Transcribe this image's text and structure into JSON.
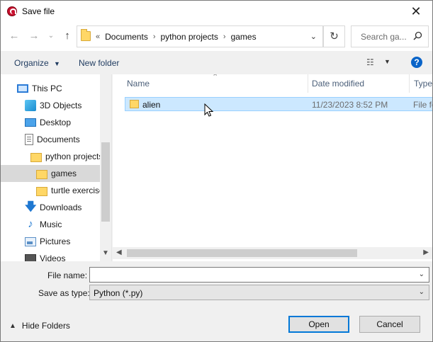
{
  "window": {
    "title": "Save file",
    "close_glyph": "✕"
  },
  "nav": {
    "back_glyph": "←",
    "forward_glyph": "→",
    "recent_glyph": "⌄",
    "up_glyph": "↑",
    "breadcrumb_prefix": "«",
    "breadcrumbs": [
      "Documents",
      "python projects",
      "games"
    ],
    "refresh_glyph": "↻",
    "search_placeholder": "Search ga..."
  },
  "toolbar": {
    "organize_label": "Organize",
    "new_folder_label": "New folder",
    "view_glyph": "☷",
    "help_glyph": "?"
  },
  "tree": [
    {
      "label": "This PC",
      "icon": "pc-icon",
      "indent": 0,
      "expand": "›"
    },
    {
      "label": "3D Objects",
      "icon": "3d-objects-icon",
      "indent": 1
    },
    {
      "label": "Desktop",
      "icon": "desktop-icon",
      "indent": 1
    },
    {
      "label": "Documents",
      "icon": "documents-icon",
      "indent": 1
    },
    {
      "label": "python projects",
      "icon": "folder-icon",
      "indent": 2
    },
    {
      "label": "games",
      "icon": "folder-icon",
      "indent": 3,
      "selected": true
    },
    {
      "label": "turtle exercises",
      "icon": "folder-icon",
      "indent": 3
    },
    {
      "label": "Downloads",
      "icon": "downloads-icon",
      "indent": 1
    },
    {
      "label": "Music",
      "icon": "music-icon",
      "indent": 1
    },
    {
      "label": "Pictures",
      "icon": "pictures-icon",
      "indent": 1
    },
    {
      "label": "Videos",
      "icon": "videos-icon",
      "indent": 1
    }
  ],
  "columns": {
    "name": "Name",
    "date": "Date modified",
    "type": "Type"
  },
  "files": [
    {
      "name": "alien",
      "date": "11/23/2023 8:52 PM",
      "type": "File folder"
    }
  ],
  "form": {
    "file_name_label": "File name:",
    "file_name_value": "",
    "save_type_label": "Save as type:",
    "save_type_value": "Python (*.py)"
  },
  "footer": {
    "hide_folders_label": "Hide Folders",
    "open_label": "Open",
    "cancel_label": "Cancel"
  },
  "colors": {
    "selection": "#cce8ff",
    "accent": "#0078d7"
  }
}
